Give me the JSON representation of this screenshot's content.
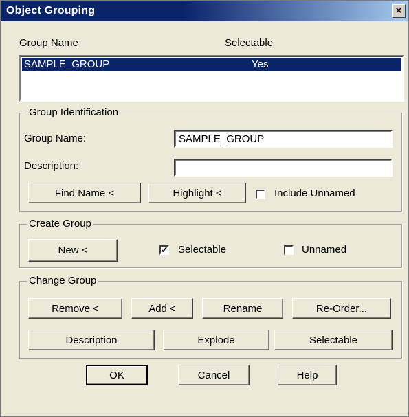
{
  "window": {
    "title": "Object Grouping",
    "close_glyph": "×"
  },
  "list": {
    "headers": {
      "name": "Group Name",
      "selectable": "Selectable"
    },
    "rows": [
      {
        "name": "SAMPLE_GROUP",
        "selectable": "Yes"
      }
    ]
  },
  "group_identification": {
    "legend": "Group Identification",
    "group_name_label": "Group Name:",
    "group_name_value": "SAMPLE_GROUP",
    "description_label": "Description:",
    "description_value": "",
    "find_name_button": "Find Name <",
    "highlight_button": "Highlight <",
    "include_unnamed_label": "Include Unnamed",
    "include_unnamed_checked": false
  },
  "create_group": {
    "legend": "Create Group",
    "new_button": "New <",
    "selectable_label": "Selectable",
    "selectable_checked": true,
    "unnamed_label": "Unnamed",
    "unnamed_checked": false
  },
  "change_group": {
    "legend": "Change Group",
    "remove_button": "Remove <",
    "add_button": "Add <",
    "rename_button": "Rename",
    "reorder_button": "Re-Order...",
    "description_button": "Description",
    "explode_button": "Explode",
    "selectable_button": "Selectable"
  },
  "footer": {
    "ok_button": "OK",
    "cancel_button": "Cancel",
    "help_button": "Help"
  }
}
